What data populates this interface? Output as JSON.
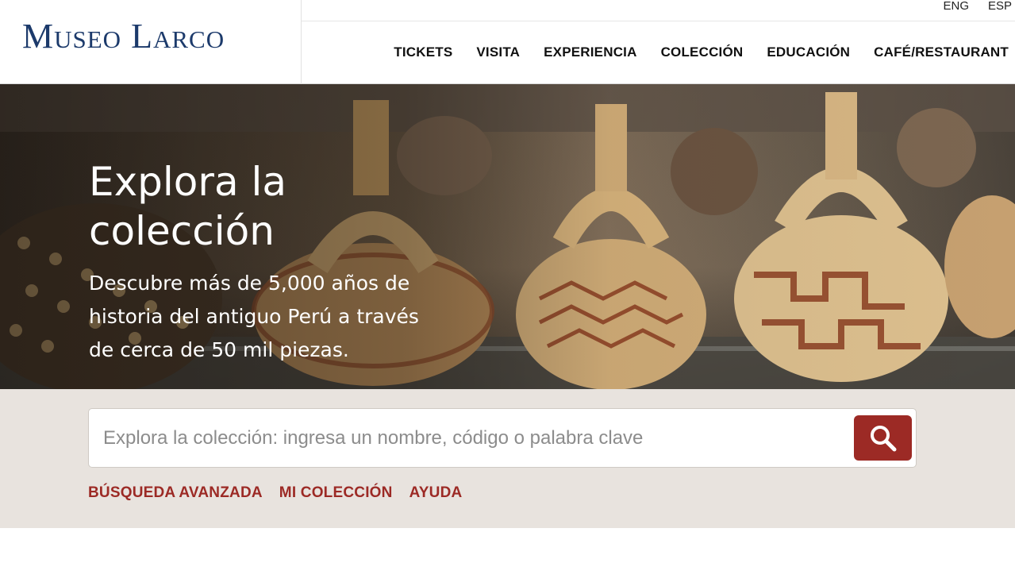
{
  "header": {
    "logo_text": "Museo Larco",
    "languages": [
      "ENG",
      "ESP"
    ],
    "nav": [
      "TICKETS",
      "VISITA",
      "EXPERIENCIA",
      "COLECCIÓN",
      "EDUCACIÓN",
      "CAFÉ/RESTAURANT"
    ]
  },
  "hero": {
    "title": "Explora la colección",
    "subtitle": "Descubre más de 5,000 años de historia del antiguo Perú a través de cerca de 50 mil piezas."
  },
  "search": {
    "placeholder": "Explora la colección: ingresa un nombre, código o palabra clave",
    "button_icon": "search-icon"
  },
  "links": [
    "BÚSQUEDA AVANZADA",
    "MI COLECCIÓN",
    "AYUDA"
  ],
  "colors": {
    "brand_blue": "#1c3a6b",
    "accent_red": "#9c2a25",
    "band_bg": "#e8e3de"
  }
}
